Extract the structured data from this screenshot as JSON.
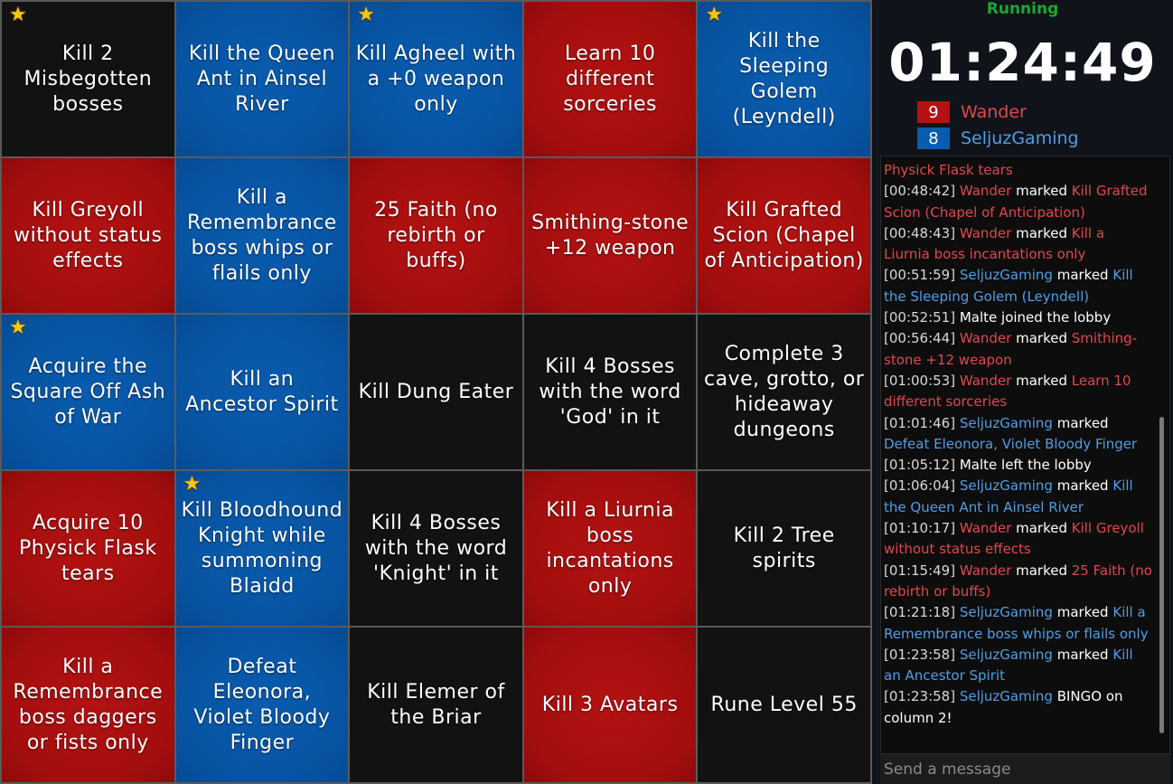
{
  "board": {
    "cells": [
      {
        "text": "Kill 2 Misbegotten bosses",
        "color": "none",
        "star": true
      },
      {
        "text": "Kill the Queen Ant in Ainsel River",
        "color": "blue",
        "star": false
      },
      {
        "text": "Kill Agheel with a +0 weapon only",
        "color": "blue",
        "star": true
      },
      {
        "text": "Learn 10 different sorceries",
        "color": "red",
        "star": false
      },
      {
        "text": "Kill the Sleeping Golem (Leyndell)",
        "color": "blue",
        "star": true
      },
      {
        "text": "Kill Greyoll without status effects",
        "color": "red",
        "star": false
      },
      {
        "text": "Kill a Remembrance boss whips or flails only",
        "color": "blue",
        "star": false
      },
      {
        "text": "25 Faith (no rebirth or buffs)",
        "color": "red",
        "star": false
      },
      {
        "text": "Smithing-stone +12 weapon",
        "color": "red",
        "star": false
      },
      {
        "text": "Kill Grafted Scion (Chapel of Anticipation)",
        "color": "red",
        "star": false
      },
      {
        "text": "Acquire the Square Off Ash of War",
        "color": "blue",
        "star": true
      },
      {
        "text": "Kill an Ancestor Spirit",
        "color": "blue",
        "star": false
      },
      {
        "text": "Kill Dung Eater",
        "color": "none",
        "star": false
      },
      {
        "text": "Kill 4 Bosses with the word 'God' in it",
        "color": "none",
        "star": false
      },
      {
        "text": "Complete 3 cave, grotto, or hideaway dungeons",
        "color": "none",
        "star": false
      },
      {
        "text": "Acquire 10 Physick Flask tears",
        "color": "red",
        "star": false
      },
      {
        "text": "Kill Bloodhound Knight while summoning Blaidd",
        "color": "blue",
        "star": true
      },
      {
        "text": "Kill 4 Bosses with the word 'Knight' in it",
        "color": "none",
        "star": false
      },
      {
        "text": "Kill a Liurnia boss incantations only",
        "color": "red",
        "star": false
      },
      {
        "text": "Kill 2 Tree spirits",
        "color": "none",
        "star": false
      },
      {
        "text": "Kill a Remembrance boss daggers or fists only",
        "color": "red",
        "star": false
      },
      {
        "text": "Defeat Eleonora, Violet Bloody Finger",
        "color": "blue",
        "star": false
      },
      {
        "text": "Kill Elemer of the Briar",
        "color": "none",
        "star": false
      },
      {
        "text": "Kill 3 Avatars",
        "color": "red",
        "star": false
      },
      {
        "text": "Rune Level 55",
        "color": "none",
        "star": false
      }
    ]
  },
  "sidebar": {
    "status": "Running",
    "timer": "01:24:49",
    "players": [
      {
        "score": "9",
        "name": "Wander",
        "color": "#b31212"
      },
      {
        "score": "8",
        "name": "SeljuzGaming",
        "color": "#0a5cae"
      }
    ]
  },
  "chat": {
    "messages": [
      {
        "segments": [
          {
            "text": "Physick Flask tears",
            "color": "red"
          }
        ]
      },
      {
        "segments": [
          {
            "text": "[00:48:42] ",
            "color": "time"
          },
          {
            "text": "Wander",
            "color": "red"
          },
          {
            "text": " marked ",
            "color": "white"
          },
          {
            "text": "Kill Grafted Scion (Chapel of Anticipation)",
            "color": "red"
          }
        ]
      },
      {
        "segments": [
          {
            "text": "[00:48:43] ",
            "color": "time"
          },
          {
            "text": "Wander",
            "color": "red"
          },
          {
            "text": " marked ",
            "color": "white"
          },
          {
            "text": "Kill a Liurnia boss incantations only",
            "color": "red"
          }
        ]
      },
      {
        "segments": [
          {
            "text": "[00:51:59] ",
            "color": "time"
          },
          {
            "text": "SeljuzGaming",
            "color": "blue"
          },
          {
            "text": " marked ",
            "color": "white"
          },
          {
            "text": "Kill the Sleeping Golem (Leyndell)",
            "color": "blue"
          }
        ]
      },
      {
        "segments": [
          {
            "text": "[00:52:51] ",
            "color": "time"
          },
          {
            "text": "Malte joined the lobby",
            "color": "white"
          }
        ]
      },
      {
        "segments": [
          {
            "text": "[00:56:44] ",
            "color": "time"
          },
          {
            "text": "Wander",
            "color": "red"
          },
          {
            "text": " marked ",
            "color": "white"
          },
          {
            "text": "Smithing-stone +12 weapon",
            "color": "red"
          }
        ]
      },
      {
        "segments": [
          {
            "text": "[01:00:53] ",
            "color": "time"
          },
          {
            "text": "Wander",
            "color": "red"
          },
          {
            "text": " marked ",
            "color": "white"
          },
          {
            "text": "Learn 10 different sorceries",
            "color": "red"
          }
        ]
      },
      {
        "segments": [
          {
            "text": "[01:01:46] ",
            "color": "time"
          },
          {
            "text": "SeljuzGaming",
            "color": "blue"
          },
          {
            "text": " marked ",
            "color": "white"
          },
          {
            "text": "Defeat Eleonora, Violet Bloody Finger",
            "color": "blue"
          }
        ]
      },
      {
        "segments": [
          {
            "text": "[01:05:12] ",
            "color": "time"
          },
          {
            "text": "Malte left the lobby",
            "color": "white"
          }
        ]
      },
      {
        "segments": [
          {
            "text": "[01:06:04] ",
            "color": "time"
          },
          {
            "text": "SeljuzGaming",
            "color": "blue"
          },
          {
            "text": " marked ",
            "color": "white"
          },
          {
            "text": "Kill the Queen Ant in Ainsel River",
            "color": "blue"
          }
        ]
      },
      {
        "segments": [
          {
            "text": "[01:10:17] ",
            "color": "time"
          },
          {
            "text": "Wander",
            "color": "red"
          },
          {
            "text": " marked ",
            "color": "white"
          },
          {
            "text": "Kill Greyoll without status effects",
            "color": "red"
          }
        ]
      },
      {
        "segments": [
          {
            "text": "[01:15:49] ",
            "color": "time"
          },
          {
            "text": "Wander",
            "color": "red"
          },
          {
            "text": " marked ",
            "color": "white"
          },
          {
            "text": "25 Faith (no rebirth or buffs)",
            "color": "red"
          }
        ]
      },
      {
        "segments": [
          {
            "text": "[01:21:18] ",
            "color": "time"
          },
          {
            "text": "SeljuzGaming",
            "color": "blue"
          },
          {
            "text": " marked ",
            "color": "white"
          },
          {
            "text": "Kill a Remembrance boss whips or flails only",
            "color": "blue"
          }
        ]
      },
      {
        "segments": [
          {
            "text": "[01:23:58] ",
            "color": "time"
          },
          {
            "text": "SeljuzGaming",
            "color": "blue"
          },
          {
            "text": " marked ",
            "color": "white"
          },
          {
            "text": "Kill an Ancestor Spirit",
            "color": "blue"
          }
        ]
      },
      {
        "segments": [
          {
            "text": "[01:23:58] ",
            "color": "time"
          },
          {
            "text": "SeljuzGaming",
            "color": "blue"
          },
          {
            "text": " BINGO on column 2!",
            "color": "white"
          }
        ]
      }
    ],
    "input_placeholder": "Send a message"
  }
}
